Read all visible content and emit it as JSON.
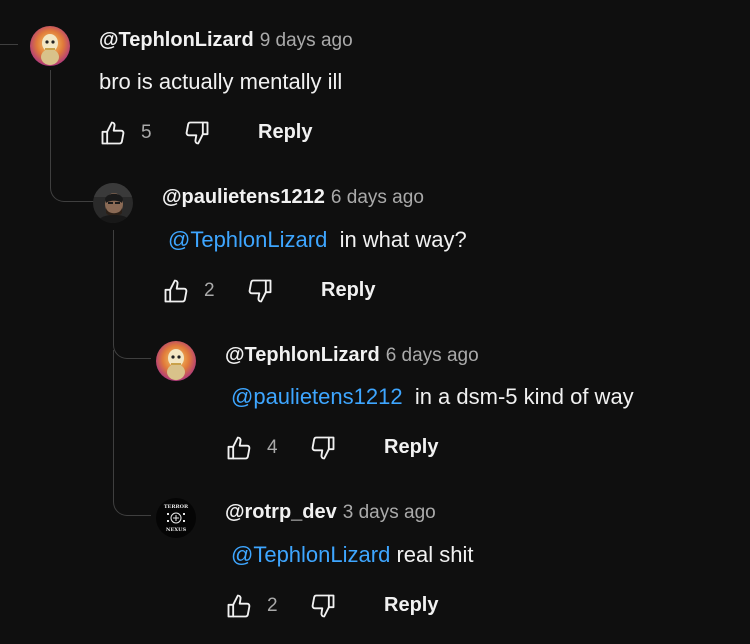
{
  "comments": [
    {
      "author": "@TephlonLizard",
      "time": "9 days ago",
      "mention": "",
      "text": "bro is actually mentally ill",
      "likes": "5",
      "reply_label": "Reply"
    },
    {
      "author": "@paulietens1212",
      "time": "6 days ago",
      "mention": "@TephlonLizard",
      "text": "in what way?",
      "likes": "2",
      "reply_label": "Reply"
    },
    {
      "author": "@TephlonLizard",
      "time": "6 days ago",
      "mention": "@paulietens1212",
      "text": "in a dsm-5 kind of way",
      "likes": "4",
      "reply_label": "Reply"
    },
    {
      "author": "@rotrp_dev",
      "time": "3 days ago",
      "mention": "@TephlonLizard",
      "text": "real shit",
      "likes": "2",
      "reply_label": "Reply"
    }
  ],
  "avatar_logo_text": [
    "TERROR",
    "NEXUS"
  ],
  "colors": {
    "background": "#0f0f0f",
    "text": "#f1f1f1",
    "secondary_text": "#aaaaaa",
    "mention": "#3ea6ff",
    "thread_line": "#3f3f3f"
  }
}
